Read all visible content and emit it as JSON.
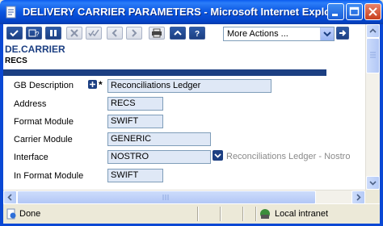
{
  "window": {
    "title": "DELIVERY CARRIER PARAMETERS - Microsoft Internet Explo..."
  },
  "toolbar": {
    "actions_select": "More Actions ..."
  },
  "page": {
    "heading": "DE.CARRIER",
    "record_id": "RECS"
  },
  "form": {
    "gb_description": {
      "label": "GB Description",
      "value": "Reconciliations Ledger",
      "required_marker": "*"
    },
    "address": {
      "label": "Address",
      "value": "RECS"
    },
    "format_module": {
      "label": "Format Module",
      "value": "SWIFT"
    },
    "carrier_module": {
      "label": "Carrier Module",
      "value": "GENERIC"
    },
    "interface": {
      "label": "Interface",
      "value": "NOSTRO",
      "enrichment": "Reconciliations Ledger - Nostro"
    },
    "in_format_module": {
      "label": "In Format Module",
      "value": "SWIFT"
    }
  },
  "status": {
    "left": "Done",
    "zone": "Local intranet"
  },
  "colors": {
    "accent": "#1c3f82",
    "titlebar": "#0a55e0",
    "field_bg": "#dfe8f6"
  }
}
